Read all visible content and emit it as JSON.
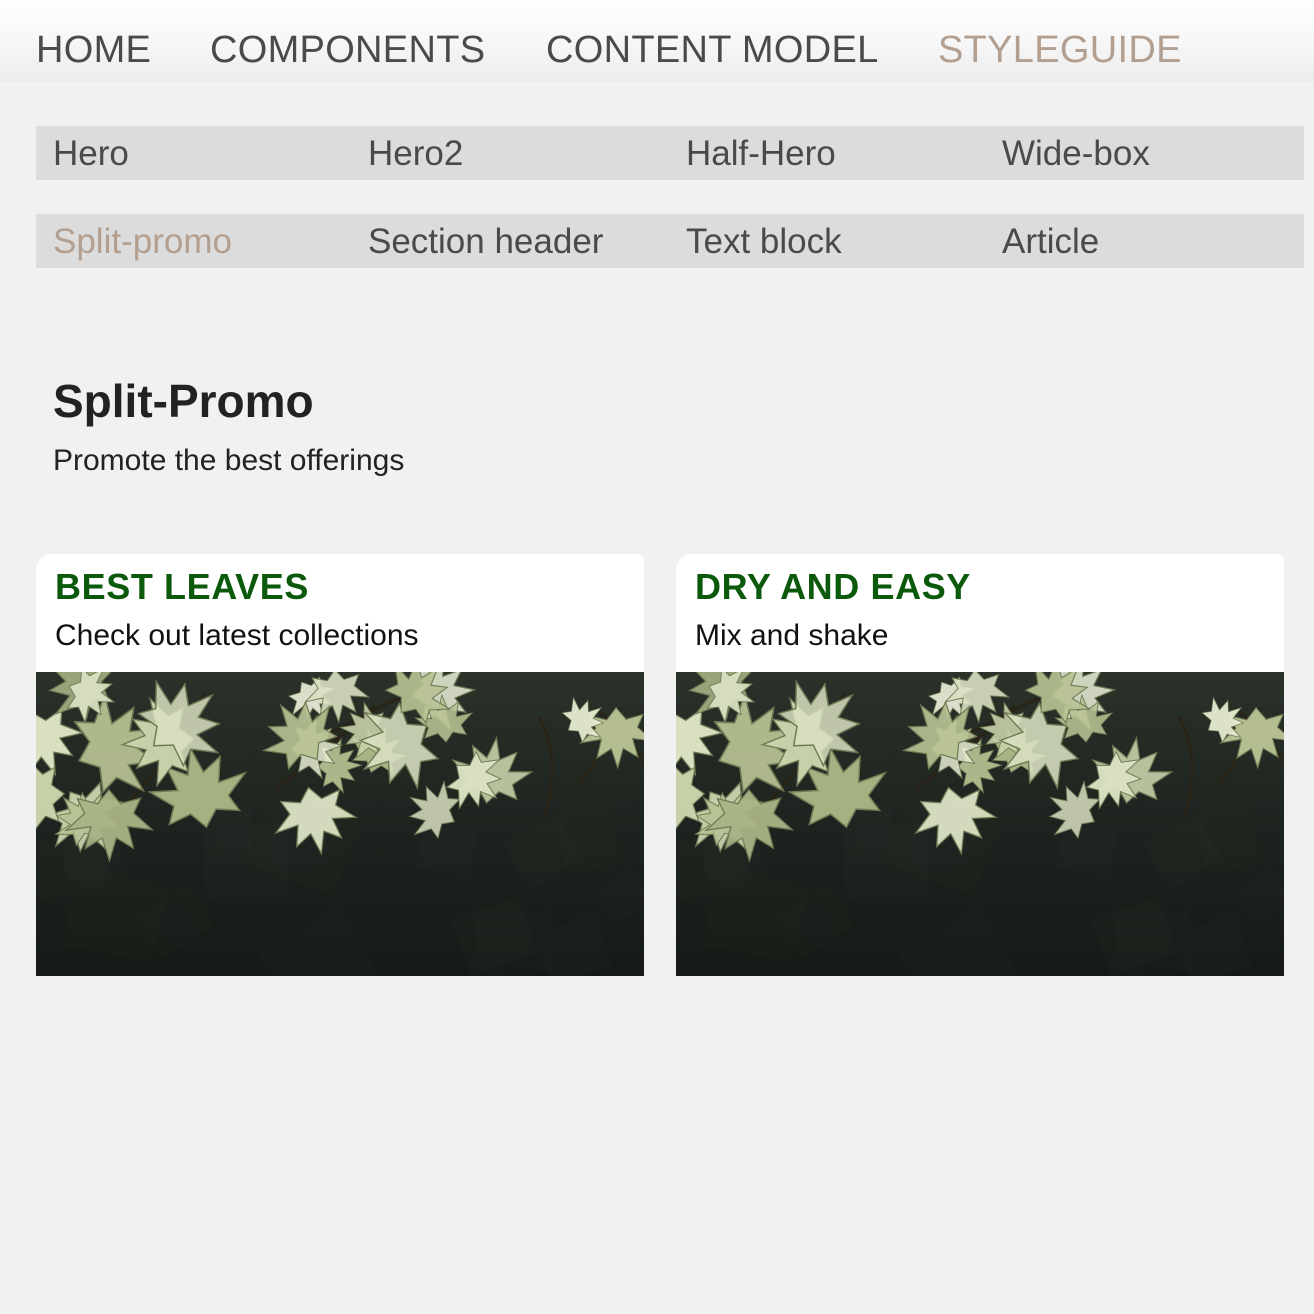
{
  "topnav": {
    "items": [
      {
        "label": "HOME",
        "active": false
      },
      {
        "label": "COMPONENTS",
        "active": false
      },
      {
        "label": "CONTENT MODEL",
        "active": false
      },
      {
        "label": "STYLEGUIDE",
        "active": true
      }
    ]
  },
  "subnav": {
    "rows": [
      [
        {
          "label": "Hero",
          "active": false
        },
        {
          "label": "Hero2",
          "active": false
        },
        {
          "label": "Half-Hero",
          "active": false
        },
        {
          "label": "Wide-box",
          "active": false
        }
      ],
      [
        {
          "label": "Split-promo",
          "active": true
        },
        {
          "label": "Section header",
          "active": false
        },
        {
          "label": "Text block",
          "active": false
        },
        {
          "label": "Article",
          "active": false
        }
      ]
    ]
  },
  "section": {
    "title": "Split-Promo",
    "subtitle": "Promote the best offerings"
  },
  "promos": [
    {
      "title": "BEST LEAVES",
      "subtitle": "Check out latest collections",
      "image": "maple-leaves-photo"
    },
    {
      "title": "DRY AND EASY",
      "subtitle": "Mix and shake",
      "image": "maple-leaves-photo"
    }
  ],
  "colors": {
    "page_background": "#f1f1f1",
    "nav_text": "#4a4a4a",
    "active_accent": "#b39f90",
    "subnav_background": "#dcdcdc",
    "promo_title": "#0b5a0b",
    "card_background": "#ffffff"
  }
}
